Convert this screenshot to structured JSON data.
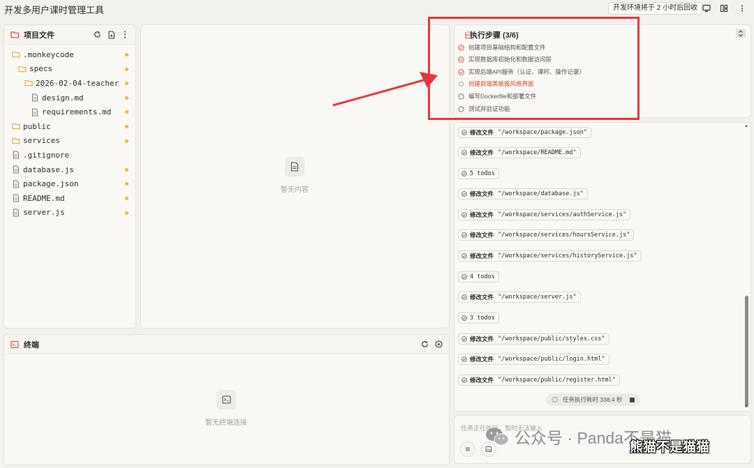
{
  "app": {
    "title": "开发多用户课时管理工具",
    "env_badge": "开发环境将于 2 小时后回收"
  },
  "project": {
    "title": "项目文件",
    "files": [
      {
        "name": ".monkeycode",
        "kind": "folder",
        "modified": true
      },
      {
        "name": "specs",
        "kind": "folder",
        "modified": true
      },
      {
        "name": "2026-02-04-teacher-…",
        "kind": "folder",
        "modified": true
      },
      {
        "name": "design.md",
        "kind": "file",
        "modified": true
      },
      {
        "name": "requirements.md",
        "kind": "file",
        "modified": true
      },
      {
        "name": "public",
        "kind": "folder",
        "modified": true
      },
      {
        "name": "services",
        "kind": "folder",
        "modified": true
      },
      {
        "name": ".gitignore",
        "kind": "file",
        "modified": false
      },
      {
        "name": "database.js",
        "kind": "file",
        "modified": true
      },
      {
        "name": "package.json",
        "kind": "file",
        "modified": true
      },
      {
        "name": "README.md",
        "kind": "file",
        "modified": true
      },
      {
        "name": "server.js",
        "kind": "file",
        "modified": true
      }
    ]
  },
  "editor": {
    "empty_text": "暂无内容"
  },
  "terminal": {
    "title": "终端",
    "empty_text": "暂无终端连接"
  },
  "steps": {
    "title": "执行步骤 (3/6)",
    "items": [
      {
        "label": "创建项目基础结构和配置文件",
        "status": "done"
      },
      {
        "label": "实现数据库初始化和数据访问层",
        "status": "done"
      },
      {
        "label": "实现后端API服务（认证、课时、操作记录）",
        "status": "done"
      },
      {
        "label": "创建前端黑板报风格界面",
        "status": "in-progress"
      },
      {
        "label": "编写Dockerfile和部署文件",
        "status": "pending"
      },
      {
        "label": "测试并验证功能",
        "status": "pending"
      }
    ]
  },
  "log": {
    "entries": [
      {
        "verb": "修改文件",
        "text": "\"/workspace/package.json\""
      },
      {
        "verb": "修改文件",
        "text": "\"/workspace/README.md\""
      },
      {
        "verb": "",
        "text": "5 todos"
      },
      {
        "verb": "修改文件",
        "text": "\"/workspace/database.js\""
      },
      {
        "verb": "修改文件",
        "text": "\"/workspace/services/authService.js\""
      },
      {
        "verb": "修改文件",
        "text": "\"/workspace/services/hoursService.js\""
      },
      {
        "verb": "修改文件",
        "text": "\"/workspace/services/historyService.js\""
      },
      {
        "verb": "",
        "text": "4 todos"
      },
      {
        "verb": "修改文件",
        "text": "\"/workspace/server.js\""
      },
      {
        "verb": "",
        "text": "3 todos"
      },
      {
        "verb": "修改文件",
        "text": "\"/workspace/public/styles.css\""
      },
      {
        "verb": "修改文件",
        "text": "\"/workspace/public/login.html\""
      },
      {
        "verb": "修改文件",
        "text": "\"/workspace/public/register.html\""
      }
    ],
    "timer_text": "任务执行耗时 338.4 秒"
  },
  "input": {
    "placeholder": "任务正在执行，暂时无法输入"
  },
  "watermark": {
    "text": "公众号 · Panda不是猫",
    "brand": "熊猫不是猫猫"
  },
  "colors": {
    "accent": "#d9452d",
    "highlight": "#e8353a",
    "modified_dot": "#f2b43b",
    "folder": "#e8a53a"
  }
}
